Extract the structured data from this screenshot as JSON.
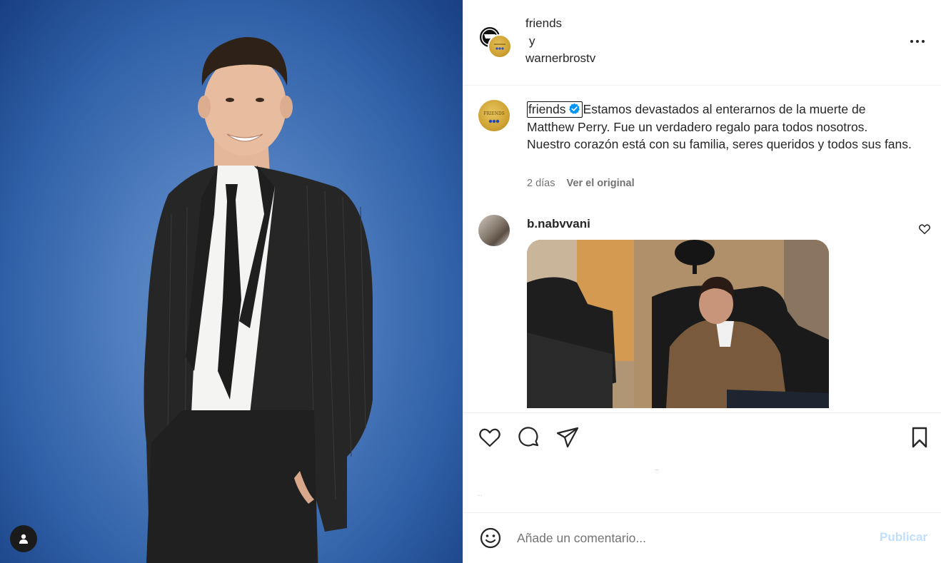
{
  "header": {
    "author_1": "friends",
    "conjunction": "y",
    "author_2": "warnerbrostv"
  },
  "caption": {
    "username": "friends",
    "text": "Estamos devastados al enterarnos de la muerte de Matthew Perry. Fue un verdadero regalo para todos nosotros. Nuestro corazón está con su familia, seres queridos y todos sus fans.",
    "time": "2 días",
    "see_original": "Ver el original"
  },
  "comment": {
    "username": "b.nabvvani"
  },
  "add_comment": {
    "placeholder": "Añade un comentario...",
    "publish_label": "Publicar"
  },
  "icons": {
    "more": "more-horizontal-icon",
    "verified": "verified-badge-icon",
    "like": "heart-icon",
    "comment": "comment-bubble-icon",
    "share": "paper-plane-icon",
    "save": "bookmark-icon",
    "emoji": "smiley-icon",
    "tag_user": "user-icon"
  },
  "colors": {
    "verified_blue": "#0095f6",
    "publish_disabled": "#c0dffd"
  }
}
